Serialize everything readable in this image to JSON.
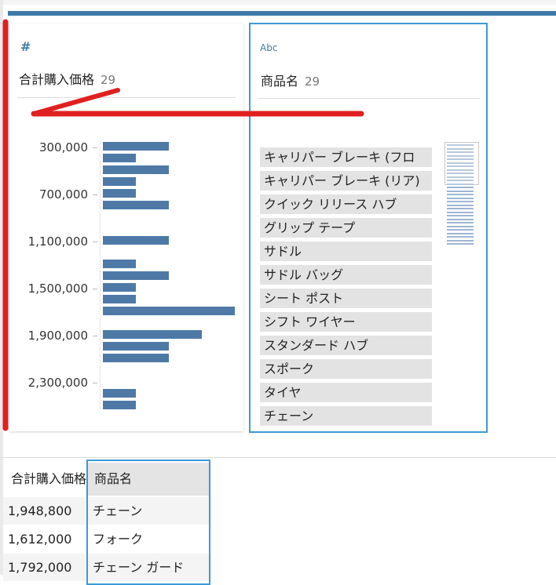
{
  "profile": {
    "price_column": {
      "type_icon": "#",
      "title": "合計購入価格",
      "count": "29",
      "ticks": [
        "300,000",
        "700,000",
        "1,100,000",
        "1,500,000",
        "1,900,000",
        "2,300,000"
      ],
      "histogram_bar_lengths": [
        0.5,
        0.25,
        0.5,
        0.25,
        0.25,
        0.5,
        0,
        0,
        0.5,
        0,
        0.25,
        0.5,
        0.25,
        0.25,
        1.0,
        0,
        0.75,
        0.5,
        0.5,
        0,
        0,
        0.25,
        0.25
      ]
    },
    "name_column": {
      "type_icon": "Abc",
      "title": "商品名",
      "count": "29",
      "items": [
        "キャリパー ブレーキ (フロ",
        "キャリパー ブレーキ (リア)",
        "クイック リリース ハブ",
        "グリップ テープ",
        "サドル",
        "サドル バッグ",
        "シート ポスト",
        "シフト ワイヤー",
        "スタンダード ハブ",
        "スポーク",
        "タイヤ",
        "チェーン"
      ]
    }
  },
  "grid": {
    "headers": {
      "price": "合計購入価格",
      "name": "商品名"
    },
    "rows": [
      {
        "price": "1,948,800",
        "name": "チェーン"
      },
      {
        "price": "1,612,000",
        "name": "フォーク"
      },
      {
        "price": "1,792,000",
        "name": "チェーン ガード"
      }
    ]
  },
  "colors": {
    "accent": "#3e7aa6",
    "bar": "#4e79a7",
    "selection": "#3c9ad6",
    "annotation": "#e02020"
  }
}
